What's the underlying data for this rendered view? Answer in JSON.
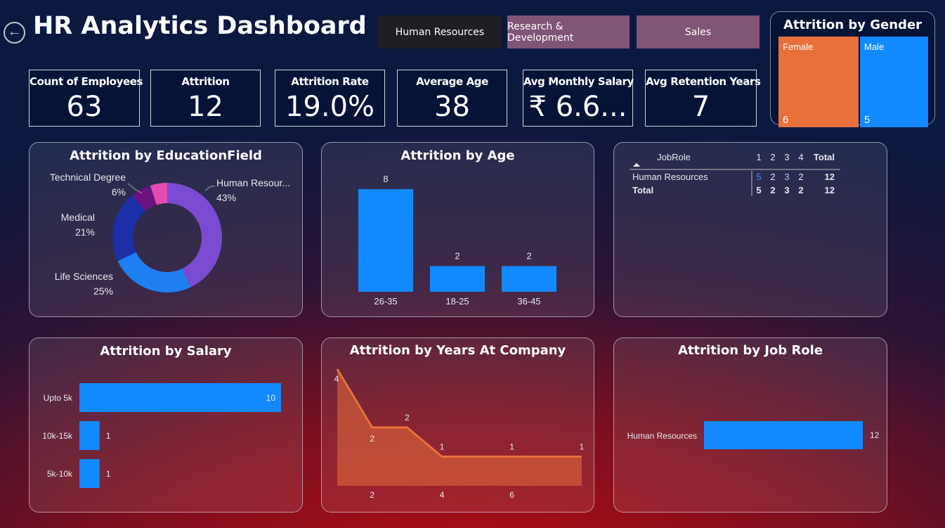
{
  "header": {
    "title": "HR Analytics Dashboard",
    "tabs": [
      {
        "label": "Human Resources",
        "active": true
      },
      {
        "label": "Research & Development",
        "active": false
      },
      {
        "label": "Sales",
        "active": false
      }
    ]
  },
  "kpis": [
    {
      "label": "Count of Employees",
      "value": "63"
    },
    {
      "label": "Attrition",
      "value": "12"
    },
    {
      "label": "Attrition Rate",
      "value": "19.0%"
    },
    {
      "label": "Average Age",
      "value": "38"
    },
    {
      "label": "Avg Monthly Salary",
      "value": "₹ 6.6..."
    },
    {
      "label": "Avg Retention Years",
      "value": "7"
    }
  ],
  "colors": {
    "accent": "#1389ff",
    "orange": "#e8703a",
    "tab_inactive": "#815576",
    "tab_active": "#1e1f22"
  },
  "chart_data": [
    {
      "type": "treemap",
      "title": "Attrition by Gender",
      "categories": [
        "Female",
        "Male"
      ],
      "values": [
        6,
        5
      ],
      "colors": [
        "#e8703a",
        "#1389ff"
      ]
    },
    {
      "type": "pie",
      "title": "Attrition by EducationField",
      "categories": [
        "Human Resour...",
        "Life Sciences",
        "Medical",
        "Technical Degree",
        ""
      ],
      "values": [
        43,
        25,
        21,
        6,
        5
      ],
      "value_labels": [
        "43%",
        "25%",
        "21%",
        "6%",
        ""
      ],
      "colors": [
        "#7a4bd0",
        "#1e80f0",
        "#1a2fa8",
        "#6b1380",
        "#e24bb0"
      ]
    },
    {
      "type": "bar",
      "title": "Attrition by Age",
      "categories": [
        "26-35",
        "18-25",
        "36-45"
      ],
      "values": [
        8,
        2,
        2
      ],
      "ylim": [
        0,
        8
      ]
    },
    {
      "type": "table",
      "columns": [
        "JobRole",
        "1",
        "2",
        "3",
        "4",
        "Total"
      ],
      "rows": [
        [
          "Human Resources",
          "5",
          "2",
          "3",
          "2",
          "12"
        ],
        [
          "Total",
          "5",
          "2",
          "3",
          "2",
          "12"
        ]
      ]
    },
    {
      "type": "bar",
      "orientation": "horizontal",
      "title": "Attrition by Salary",
      "categories": [
        "Upto 5k",
        "10k-15k",
        "5k-10k"
      ],
      "values": [
        10,
        1,
        1
      ]
    },
    {
      "type": "area",
      "title": "Attrition by Years At Company",
      "x": [
        0,
        1,
        2,
        3,
        4,
        5,
        6,
        7
      ],
      "values": [
        4,
        2,
        2,
        1,
        1,
        1,
        1,
        1
      ],
      "value_labels": [
        "4",
        "2",
        "2",
        "1",
        "",
        "1",
        "",
        "1"
      ],
      "xticks": [
        "2",
        "4",
        "6"
      ],
      "xtick_values": [
        1,
        3,
        5
      ]
    },
    {
      "type": "bar",
      "orientation": "horizontal",
      "title": "Attrition by Job Role",
      "categories": [
        "Human Resources"
      ],
      "values": [
        12
      ]
    }
  ]
}
